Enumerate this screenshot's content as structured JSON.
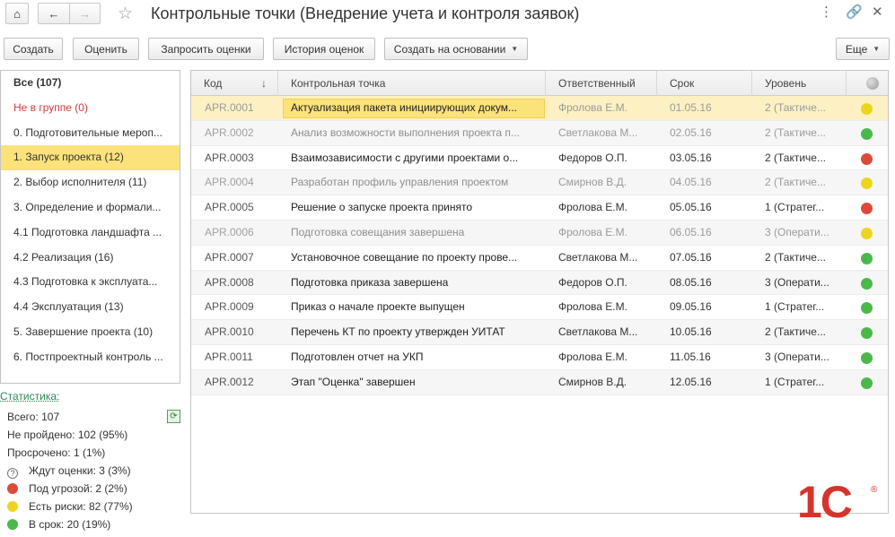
{
  "window": {
    "title": "Контрольные точки (Внедрение учета и контроля заявок)",
    "icons": {
      "home": "home-icon",
      "back": "arrow-left-icon",
      "forward": "arrow-right-icon",
      "favorite": "star-icon",
      "more": "more-icon",
      "link": "link-icon",
      "close": "close-icon"
    }
  },
  "toolbar": {
    "create": "Создать",
    "evaluate": "Оценить",
    "request_estimates": "Запросить оценки",
    "history": "История оценок",
    "create_based_on": "Создать на основании",
    "more": "Еще"
  },
  "groups": [
    {
      "label": "Все (107)",
      "style": "all"
    },
    {
      "label": "Не в группе (0)",
      "style": "red"
    },
    {
      "label": "0. Подготовительные мероп...",
      "style": ""
    },
    {
      "label": "1. Запуск проекта (12)",
      "style": "selected"
    },
    {
      "label": "2. Выбор исполнителя (11)",
      "style": ""
    },
    {
      "label": "3. Определение и формали...",
      "style": ""
    },
    {
      "label": "4.1 Подготовка ландшафта ...",
      "style": ""
    },
    {
      "label": "4.2 Реализация (16)",
      "style": ""
    },
    {
      "label": "4.3 Подготовка к эксплуата...",
      "style": ""
    },
    {
      "label": "4.4 Эксплуатация (13)",
      "style": ""
    },
    {
      "label": "5. Завершение проекта (10)",
      "style": ""
    },
    {
      "label": "6. Постпроектный контроль ...",
      "style": ""
    }
  ],
  "stats": {
    "title": "Статистика:",
    "total": "Всего: 107",
    "not_passed": "Не пройдено: 102 (95%)",
    "overdue": "Просрочено: 1 (1%)",
    "awaiting": "Ждут оценки: 3 (3%)",
    "threat": "Под угрозой: 2 (2%)",
    "risks": "Есть риски: 82 (77%)",
    "on_time": "В срок: 20 (19%)"
  },
  "table": {
    "columns": [
      "Код",
      "Контрольная точка",
      "Ответственный",
      "Срок",
      "Уровень"
    ],
    "sort_indicator": "↓",
    "rows": [
      {
        "code": "APR.0001",
        "name": "Актуализация пакета инициирующих докум...",
        "owner": "Фролова Е.М.",
        "due": "01.05.16",
        "level": "2 (Тактиче...",
        "status": "yellow",
        "dim": true,
        "selected": true
      },
      {
        "code": "APR.0002",
        "name": "Анализ возможности выполнения проекта п...",
        "owner": "Светлакова М...",
        "due": "02.05.16",
        "level": "2 (Тактиче...",
        "status": "green",
        "dim": true
      },
      {
        "code": "APR.0003",
        "name": "Взаимозависимости с другими проектами о...",
        "owner": "Федоров О.П.",
        "due": "03.05.16",
        "level": "2 (Тактиче...",
        "status": "red",
        "dim": false
      },
      {
        "code": "APR.0004",
        "name": "Разработан профиль управления проектом",
        "owner": "Смирнов В.Д.",
        "due": "04.05.16",
        "level": "2 (Тактиче...",
        "status": "yellow",
        "dim": true
      },
      {
        "code": "APR.0005",
        "name": "Решение о запуске проекта принято",
        "owner": "Фролова Е.М.",
        "due": "05.05.16",
        "level": "1 (Стратег...",
        "status": "red",
        "dim": false
      },
      {
        "code": "APR.0006",
        "name": "Подготовка совещания завершена",
        "owner": "Фролова Е.М.",
        "due": "06.05.16",
        "level": "3 (Операти...",
        "status": "yellow",
        "dim": true
      },
      {
        "code": "APR.0007",
        "name": "Установочное совещание  по проекту прове...",
        "owner": "Светлакова М...",
        "due": "07.05.16",
        "level": "2 (Тактиче...",
        "status": "green",
        "dim": false
      },
      {
        "code": "APR.0008",
        "name": "Подготовка приказа завершена",
        "owner": "Федоров О.П.",
        "due": "08.05.16",
        "level": "3 (Операти...",
        "status": "green",
        "dim": false
      },
      {
        "code": "APR.0009",
        "name": "Приказ о начале проекте выпущен",
        "owner": "Фролова Е.М.",
        "due": "09.05.16",
        "level": "1 (Стратег...",
        "status": "green",
        "dim": false
      },
      {
        "code": "APR.0010",
        "name": "Перечень КТ по проекту утвержден УИТАТ",
        "owner": "Светлакова М...",
        "due": "10.05.16",
        "level": "2 (Тактиче...",
        "status": "green",
        "dim": false
      },
      {
        "code": "APR.0011",
        "name": "Подготовлен отчет на УКП",
        "owner": "Фролова Е.М.",
        "due": "11.05.16",
        "level": "3 (Операти...",
        "status": "green",
        "dim": false
      },
      {
        "code": "APR.0012",
        "name": "Этап \"Оценка\" завершен",
        "owner": "Смирнов В.Д.",
        "due": "12.05.16",
        "level": "1 (Стратег...",
        "status": "green",
        "dim": false
      }
    ]
  },
  "status_colors": {
    "yellow": "#ecd51e",
    "green": "#4cb84c",
    "red": "#dc4b3a"
  },
  "logo": {
    "text": "1С",
    "reg": "®"
  }
}
